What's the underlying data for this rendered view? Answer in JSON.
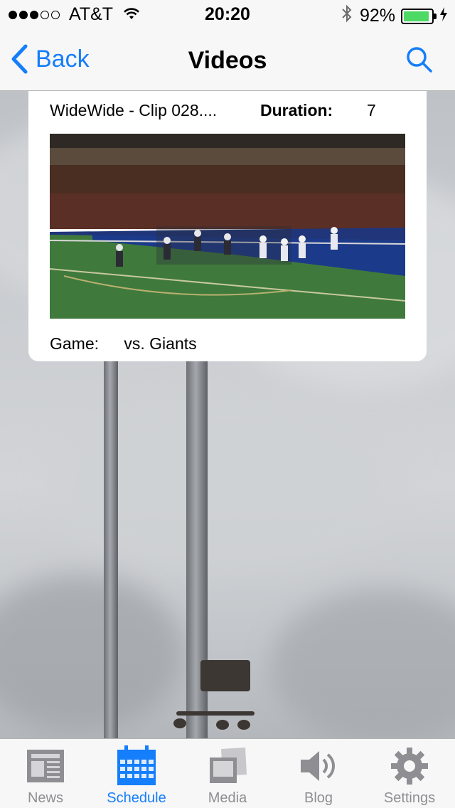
{
  "status_bar": {
    "signal_strength": "3 of 5",
    "carrier": "AT&T",
    "wifi_icon": "wifi-icon",
    "time": "20:20",
    "bluetooth_icon": "bluetooth-icon",
    "battery_percent": "92%",
    "battery_level": 0.92,
    "charging_icon": "bolt-icon"
  },
  "nav": {
    "back_label": "Back",
    "title": "Videos",
    "search_icon": "search-icon",
    "accent_color": "#157efb"
  },
  "video_card": {
    "clip_title": "WideWide - Clip 028....",
    "duration_label": "Duration:",
    "duration_value": "7",
    "game_label": "Game:",
    "game_value": "vs. Giants"
  },
  "tab_bar": {
    "tabs": [
      {
        "label": "News",
        "icon": "newspaper-icon",
        "active": false
      },
      {
        "label": "Schedule",
        "icon": "calendar-icon",
        "active": true
      },
      {
        "label": "Media",
        "icon": "media-icon",
        "active": false
      },
      {
        "label": "Blog",
        "icon": "speaker-icon",
        "active": false
      },
      {
        "label": "Settings",
        "icon": "gear-icon",
        "active": false
      }
    ],
    "active_color": "#157efb",
    "inactive_color": "#8e8e93"
  }
}
